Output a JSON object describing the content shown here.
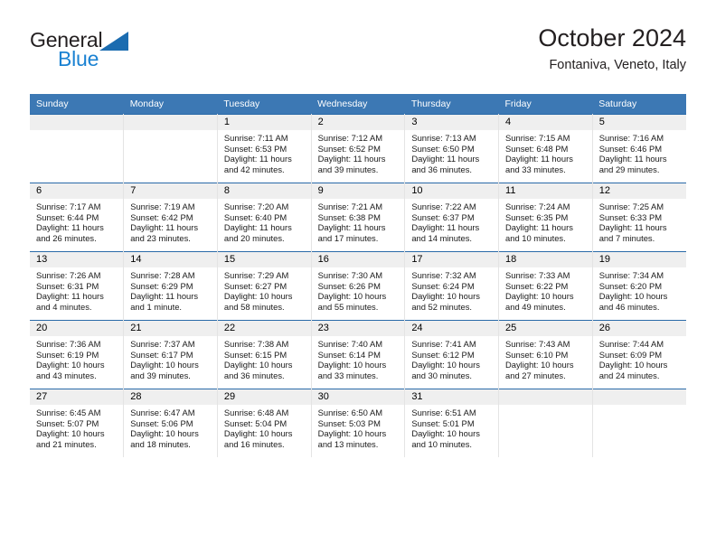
{
  "logo": {
    "word_top": "General",
    "word_bottom": "Blue",
    "triangle_color": "#1b6cb0",
    "blue_text_color": "#1b82d2",
    "dark_text_color": "#231f20"
  },
  "header": {
    "title": "October 2024",
    "subtitle": "Fontaniva, Veneto, Italy"
  },
  "theme": {
    "header_row_bg": "#3c78b4",
    "header_row_text": "#ffffff",
    "daynum_band_bg": "#efefef",
    "week_separator": "#2a6aa8",
    "cell_divider": "#e4e4e4"
  },
  "weekday_headers": [
    "Sunday",
    "Monday",
    "Tuesday",
    "Wednesday",
    "Thursday",
    "Friday",
    "Saturday"
  ],
  "weeks": [
    [
      {
        "day": "",
        "sunrise": "",
        "sunset": "",
        "daylight": ""
      },
      {
        "day": "",
        "sunrise": "",
        "sunset": "",
        "daylight": ""
      },
      {
        "day": "1",
        "sunrise": "Sunrise: 7:11 AM",
        "sunset": "Sunset: 6:53 PM",
        "daylight": "Daylight: 11 hours and 42 minutes."
      },
      {
        "day": "2",
        "sunrise": "Sunrise: 7:12 AM",
        "sunset": "Sunset: 6:52 PM",
        "daylight": "Daylight: 11 hours and 39 minutes."
      },
      {
        "day": "3",
        "sunrise": "Sunrise: 7:13 AM",
        "sunset": "Sunset: 6:50 PM",
        "daylight": "Daylight: 11 hours and 36 minutes."
      },
      {
        "day": "4",
        "sunrise": "Sunrise: 7:15 AM",
        "sunset": "Sunset: 6:48 PM",
        "daylight": "Daylight: 11 hours and 33 minutes."
      },
      {
        "day": "5",
        "sunrise": "Sunrise: 7:16 AM",
        "sunset": "Sunset: 6:46 PM",
        "daylight": "Daylight: 11 hours and 29 minutes."
      }
    ],
    [
      {
        "day": "6",
        "sunrise": "Sunrise: 7:17 AM",
        "sunset": "Sunset: 6:44 PM",
        "daylight": "Daylight: 11 hours and 26 minutes."
      },
      {
        "day": "7",
        "sunrise": "Sunrise: 7:19 AM",
        "sunset": "Sunset: 6:42 PM",
        "daylight": "Daylight: 11 hours and 23 minutes."
      },
      {
        "day": "8",
        "sunrise": "Sunrise: 7:20 AM",
        "sunset": "Sunset: 6:40 PM",
        "daylight": "Daylight: 11 hours and 20 minutes."
      },
      {
        "day": "9",
        "sunrise": "Sunrise: 7:21 AM",
        "sunset": "Sunset: 6:38 PM",
        "daylight": "Daylight: 11 hours and 17 minutes."
      },
      {
        "day": "10",
        "sunrise": "Sunrise: 7:22 AM",
        "sunset": "Sunset: 6:37 PM",
        "daylight": "Daylight: 11 hours and 14 minutes."
      },
      {
        "day": "11",
        "sunrise": "Sunrise: 7:24 AM",
        "sunset": "Sunset: 6:35 PM",
        "daylight": "Daylight: 11 hours and 10 minutes."
      },
      {
        "day": "12",
        "sunrise": "Sunrise: 7:25 AM",
        "sunset": "Sunset: 6:33 PM",
        "daylight": "Daylight: 11 hours and 7 minutes."
      }
    ],
    [
      {
        "day": "13",
        "sunrise": "Sunrise: 7:26 AM",
        "sunset": "Sunset: 6:31 PM",
        "daylight": "Daylight: 11 hours and 4 minutes."
      },
      {
        "day": "14",
        "sunrise": "Sunrise: 7:28 AM",
        "sunset": "Sunset: 6:29 PM",
        "daylight": "Daylight: 11 hours and 1 minute."
      },
      {
        "day": "15",
        "sunrise": "Sunrise: 7:29 AM",
        "sunset": "Sunset: 6:27 PM",
        "daylight": "Daylight: 10 hours and 58 minutes."
      },
      {
        "day": "16",
        "sunrise": "Sunrise: 7:30 AM",
        "sunset": "Sunset: 6:26 PM",
        "daylight": "Daylight: 10 hours and 55 minutes."
      },
      {
        "day": "17",
        "sunrise": "Sunrise: 7:32 AM",
        "sunset": "Sunset: 6:24 PM",
        "daylight": "Daylight: 10 hours and 52 minutes."
      },
      {
        "day": "18",
        "sunrise": "Sunrise: 7:33 AM",
        "sunset": "Sunset: 6:22 PM",
        "daylight": "Daylight: 10 hours and 49 minutes."
      },
      {
        "day": "19",
        "sunrise": "Sunrise: 7:34 AM",
        "sunset": "Sunset: 6:20 PM",
        "daylight": "Daylight: 10 hours and 46 minutes."
      }
    ],
    [
      {
        "day": "20",
        "sunrise": "Sunrise: 7:36 AM",
        "sunset": "Sunset: 6:19 PM",
        "daylight": "Daylight: 10 hours and 43 minutes."
      },
      {
        "day": "21",
        "sunrise": "Sunrise: 7:37 AM",
        "sunset": "Sunset: 6:17 PM",
        "daylight": "Daylight: 10 hours and 39 minutes."
      },
      {
        "day": "22",
        "sunrise": "Sunrise: 7:38 AM",
        "sunset": "Sunset: 6:15 PM",
        "daylight": "Daylight: 10 hours and 36 minutes."
      },
      {
        "day": "23",
        "sunrise": "Sunrise: 7:40 AM",
        "sunset": "Sunset: 6:14 PM",
        "daylight": "Daylight: 10 hours and 33 minutes."
      },
      {
        "day": "24",
        "sunrise": "Sunrise: 7:41 AM",
        "sunset": "Sunset: 6:12 PM",
        "daylight": "Daylight: 10 hours and 30 minutes."
      },
      {
        "day": "25",
        "sunrise": "Sunrise: 7:43 AM",
        "sunset": "Sunset: 6:10 PM",
        "daylight": "Daylight: 10 hours and 27 minutes."
      },
      {
        "day": "26",
        "sunrise": "Sunrise: 7:44 AM",
        "sunset": "Sunset: 6:09 PM",
        "daylight": "Daylight: 10 hours and 24 minutes."
      }
    ],
    [
      {
        "day": "27",
        "sunrise": "Sunrise: 6:45 AM",
        "sunset": "Sunset: 5:07 PM",
        "daylight": "Daylight: 10 hours and 21 minutes."
      },
      {
        "day": "28",
        "sunrise": "Sunrise: 6:47 AM",
        "sunset": "Sunset: 5:06 PM",
        "daylight": "Daylight: 10 hours and 18 minutes."
      },
      {
        "day": "29",
        "sunrise": "Sunrise: 6:48 AM",
        "sunset": "Sunset: 5:04 PM",
        "daylight": "Daylight: 10 hours and 16 minutes."
      },
      {
        "day": "30",
        "sunrise": "Sunrise: 6:50 AM",
        "sunset": "Sunset: 5:03 PM",
        "daylight": "Daylight: 10 hours and 13 minutes."
      },
      {
        "day": "31",
        "sunrise": "Sunrise: 6:51 AM",
        "sunset": "Sunset: 5:01 PM",
        "daylight": "Daylight: 10 hours and 10 minutes."
      },
      {
        "day": "",
        "sunrise": "",
        "sunset": "",
        "daylight": ""
      },
      {
        "day": "",
        "sunrise": "",
        "sunset": "",
        "daylight": ""
      }
    ]
  ]
}
